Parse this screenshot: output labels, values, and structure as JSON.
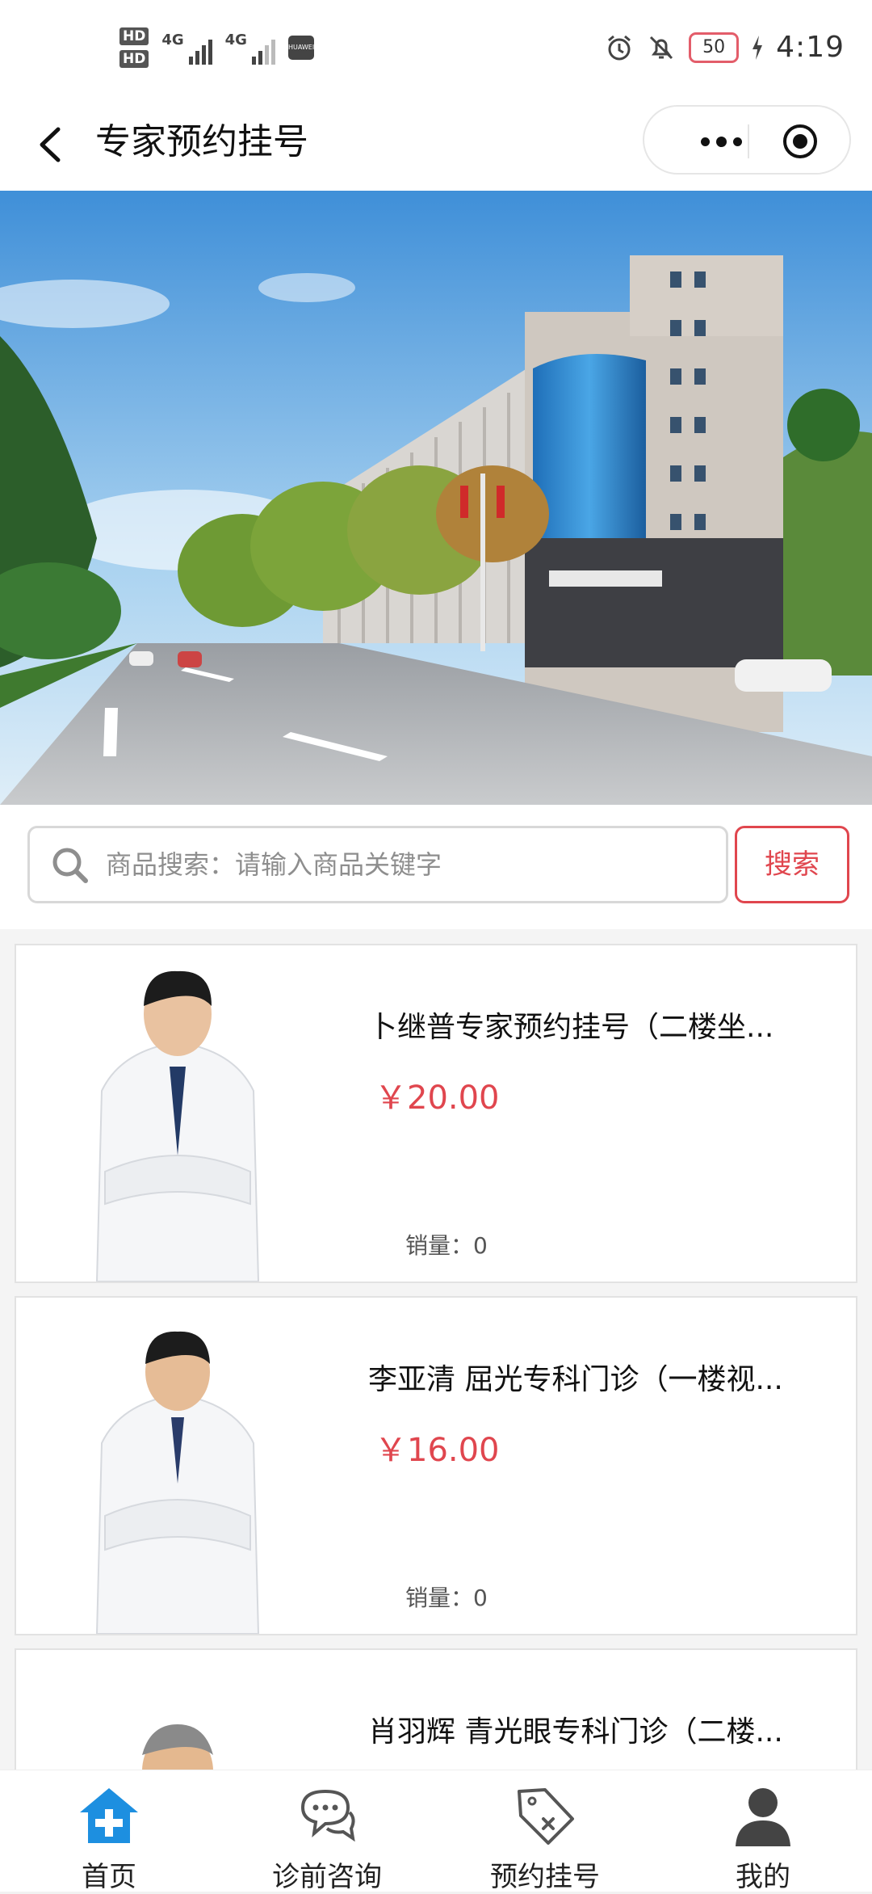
{
  "status_bar": {
    "hd1": "HD",
    "hd2": "HD",
    "net1": "4G",
    "net2": "4G",
    "brand": "HUAWEI",
    "battery": "50",
    "time": "4:19"
  },
  "nav": {
    "title": "专家预约挂号"
  },
  "search": {
    "placeholder": "商品搜索：请输入商品关键字",
    "button": "搜索"
  },
  "products": [
    {
      "title": "卜继普专家预约挂号（二楼坐...",
      "price": "￥20.00",
      "sales": "销量：0"
    },
    {
      "title": "李亚清 屈光专科门诊（一楼视...",
      "price": "￥16.00",
      "sales": "销量：0"
    },
    {
      "title": "肖羽辉  青光眼专科门诊（二楼...",
      "price": "",
      "sales": ""
    }
  ],
  "tabbar": [
    {
      "label": "首页",
      "icon": "home-plus-icon"
    },
    {
      "label": "诊前咨询",
      "icon": "chat-bubbles-icon"
    },
    {
      "label": "预约挂号",
      "icon": "tag-icon"
    },
    {
      "label": "我的",
      "icon": "person-icon"
    }
  ],
  "colors": {
    "accent_red": "#e0464e",
    "tab_active_blue": "#1d8fe0"
  }
}
